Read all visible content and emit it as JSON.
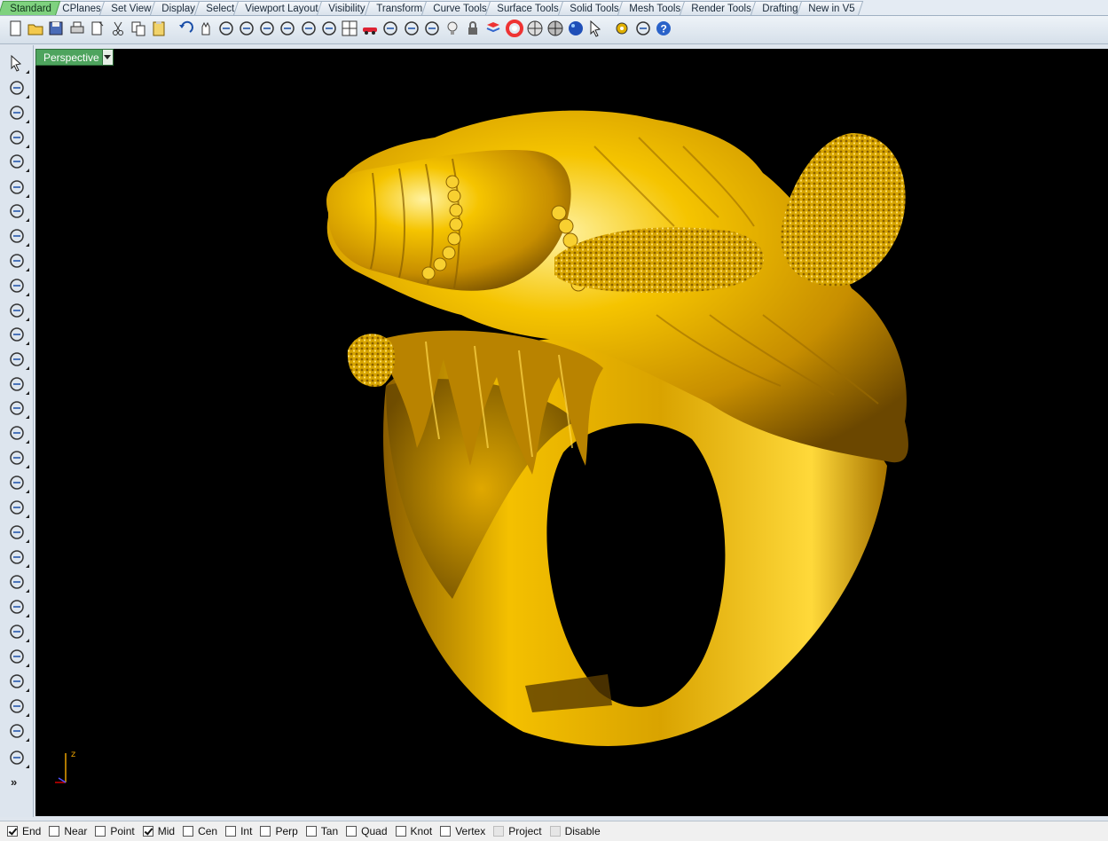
{
  "tabs": [
    "Standard",
    "CPlanes",
    "Set View",
    "Display",
    "Select",
    "Viewport Layout",
    "Visibility",
    "Transform",
    "Curve Tools",
    "Surface Tools",
    "Solid Tools",
    "Mesh Tools",
    "Render Tools",
    "Drafting",
    "New in V5"
  ],
  "active_tab": "Standard",
  "toolbar": {
    "icons": [
      "new-icon",
      "open-icon",
      "save-icon",
      "print-icon",
      "import-icon",
      "cut-icon",
      "copy-icon",
      "paste-icon",
      "undo-icon",
      "pan-icon",
      "rotate-view-icon",
      "zoom-dynamic-icon",
      "zoom-window-icon",
      "zoom-extents-icon",
      "zoom-selected-icon",
      "undo-view-icon",
      "four-viewports-icon",
      "car-icon",
      "grid-icon",
      "circle-tool-icon",
      "properties-icon",
      "light-bulb-icon",
      "lock-icon",
      "layer-icon",
      "color-wheel-icon",
      "shade-sphere-icon",
      "render-sphere-icon",
      "render-blue-sphere-icon",
      "select-arrow-icon",
      "settings-gear-icon",
      "dimension-icon",
      "help-icon"
    ]
  },
  "left_tools": {
    "icons": [
      "select-arrow-icon",
      "point-icon",
      "polyline-icon",
      "curve-icon",
      "circle-icon",
      "ellipse-icon",
      "arc-icon",
      "rectangle-icon",
      "polygon-icon",
      "fillet-curve-icon",
      "surface-corner-icon",
      "loft-surface-icon",
      "box-solid-icon",
      "boolean-union-icon",
      "cylinder-solid-icon",
      "mesh-icon",
      "gear-icon",
      "explode-icon",
      "split-icon",
      "trim-icon",
      "array-icon",
      "group-icon",
      "rotate-curve-icon",
      "offset-curve-icon",
      "text-icon",
      "move-icon",
      "align-icon",
      "transform-icon",
      "box-view-icon"
    ],
    "more_label": "»"
  },
  "viewport": {
    "name": "Perspective",
    "axis_label": "z",
    "background": "#000000",
    "object_color": "#f0c000"
  },
  "osnaps": [
    {
      "label": "End",
      "checked": true,
      "disabled": false
    },
    {
      "label": "Near",
      "checked": false,
      "disabled": false
    },
    {
      "label": "Point",
      "checked": false,
      "disabled": false
    },
    {
      "label": "Mid",
      "checked": true,
      "disabled": false
    },
    {
      "label": "Cen",
      "checked": false,
      "disabled": false
    },
    {
      "label": "Int",
      "checked": false,
      "disabled": false
    },
    {
      "label": "Perp",
      "checked": false,
      "disabled": false
    },
    {
      "label": "Tan",
      "checked": false,
      "disabled": false
    },
    {
      "label": "Quad",
      "checked": false,
      "disabled": false
    },
    {
      "label": "Knot",
      "checked": false,
      "disabled": false
    },
    {
      "label": "Vertex",
      "checked": false,
      "disabled": false
    },
    {
      "label": "Project",
      "checked": false,
      "disabled": true
    },
    {
      "label": "Disable",
      "checked": false,
      "disabled": true
    }
  ]
}
